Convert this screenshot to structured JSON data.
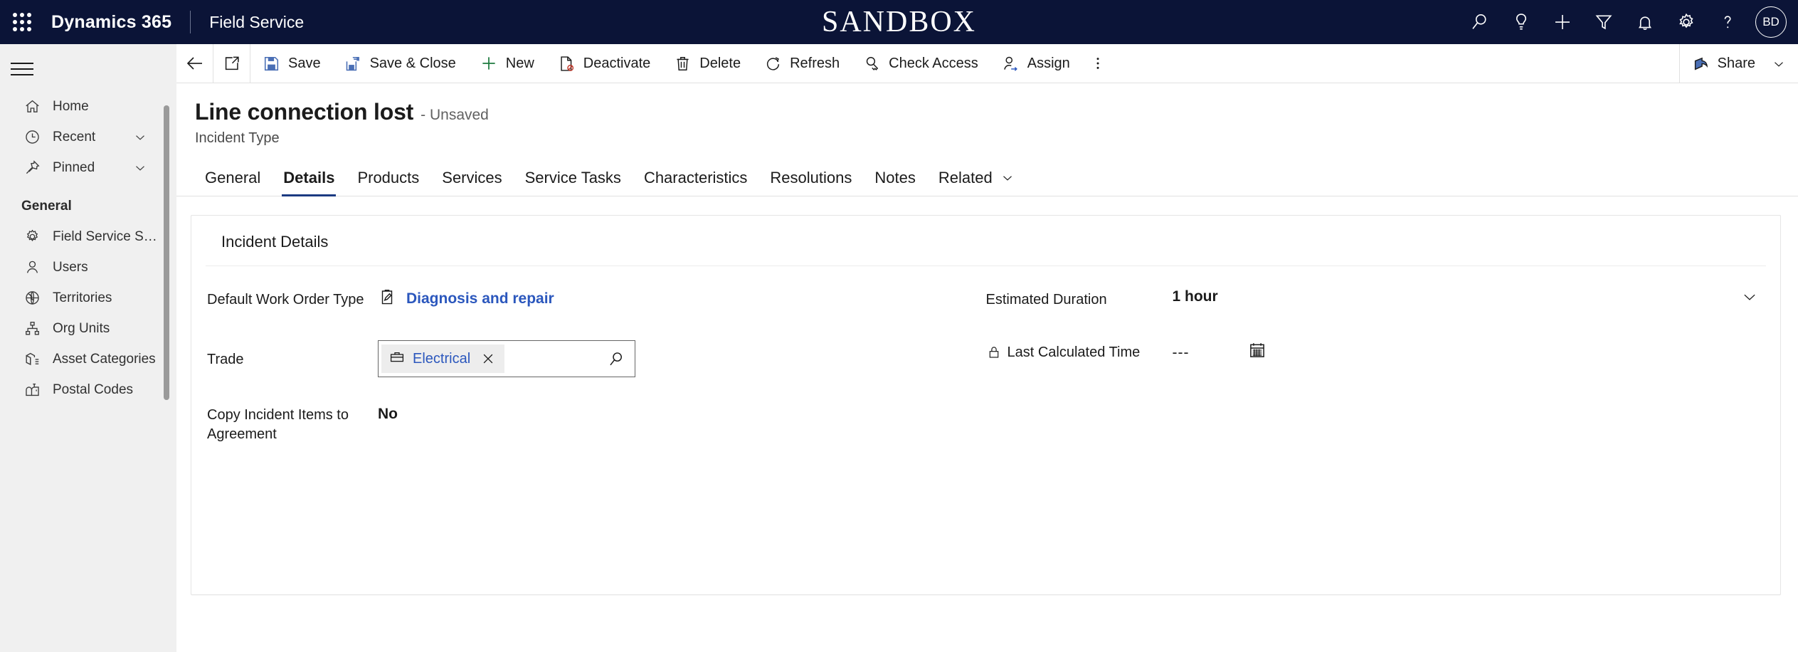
{
  "header": {
    "waffle_label": "app-launcher",
    "brand": "Dynamics 365",
    "app_name": "Field Service",
    "environment_banner": "SANDBOX",
    "icons": [
      {
        "name": "search-icon",
        "label": "Search"
      },
      {
        "name": "lightbulb-icon",
        "label": "Insights"
      },
      {
        "name": "plus-icon",
        "label": "New"
      },
      {
        "name": "filter-icon",
        "label": "Filter"
      },
      {
        "name": "bell-icon",
        "label": "Notifications"
      },
      {
        "name": "gear-icon",
        "label": "Settings"
      },
      {
        "name": "question-icon",
        "label": "Help"
      }
    ],
    "avatar_initials": "BD"
  },
  "sidebar": {
    "hamburger_label": "Expand navigation",
    "items": [
      {
        "label": "Home",
        "icon": "home-icon",
        "chevron": false
      },
      {
        "label": "Recent",
        "icon": "clock-icon",
        "chevron": true
      },
      {
        "label": "Pinned",
        "icon": "pin-icon",
        "chevron": true
      }
    ],
    "group_label": "General",
    "group_items": [
      {
        "label": "Field Service Setti...",
        "icon": "gear-icon"
      },
      {
        "label": "Users",
        "icon": "user-icon"
      },
      {
        "label": "Territories",
        "icon": "globe-icon"
      },
      {
        "label": "Org Units",
        "icon": "org-chart-icon"
      },
      {
        "label": "Asset Categories",
        "icon": "asset-box-icon"
      },
      {
        "label": "Postal Codes",
        "icon": "mailbox-icon"
      }
    ]
  },
  "command_bar": {
    "back_label": "Back",
    "popout_label": "Open in new window",
    "buttons": [
      {
        "label": "Save",
        "icon": "save-icon"
      },
      {
        "label": "Save & Close",
        "icon": "save-close-icon"
      },
      {
        "label": "New",
        "icon": "plus-icon"
      },
      {
        "label": "Deactivate",
        "icon": "deactivate-icon"
      },
      {
        "label": "Delete",
        "icon": "trash-icon"
      },
      {
        "label": "Refresh",
        "icon": "refresh-icon"
      },
      {
        "label": "Check Access",
        "icon": "key-icon"
      },
      {
        "label": "Assign",
        "icon": "assign-user-icon"
      }
    ],
    "overflow_label": "More commands",
    "share_label": "Share"
  },
  "record": {
    "title": "Line connection lost",
    "state": "- Unsaved",
    "entity": "Incident Type"
  },
  "tabs": [
    {
      "label": "General",
      "active": false
    },
    {
      "label": "Details",
      "active": true
    },
    {
      "label": "Products",
      "active": false
    },
    {
      "label": "Services",
      "active": false
    },
    {
      "label": "Service Tasks",
      "active": false
    },
    {
      "label": "Characteristics",
      "active": false
    },
    {
      "label": "Resolutions",
      "active": false
    },
    {
      "label": "Notes",
      "active": false
    },
    {
      "label": "Related",
      "active": false
    }
  ],
  "form": {
    "section_title": "Incident Details",
    "fields": {
      "default_work_order_type": {
        "label": "Default Work Order Type",
        "value": "Diagnosis and repair",
        "icon": "work-order-icon"
      },
      "trade": {
        "label": "Trade",
        "chip_value": "Electrical",
        "chip_icon": "briefcase-icon",
        "remove_label": "Remove",
        "search_label": "Lookup"
      },
      "copy_incident_items": {
        "label": "Copy Incident Items to Agreement",
        "value": "No"
      },
      "estimated_duration": {
        "label": "Estimated Duration",
        "value": "1 hour",
        "chevron_label": "Open duration list"
      },
      "last_calculated_time": {
        "label": "Last Calculated Time",
        "value": "---",
        "lock_icon": "lock-icon",
        "calendar_label": "Select date"
      }
    }
  },
  "colors": {
    "header_bg": "#0b1437",
    "accent_link": "#2b57bd",
    "tab_underline": "#1b3a82",
    "sidebar_bg": "#f0f0f0",
    "new_icon_green": "#1d7a3e",
    "deactivate_red": "#c0392b"
  }
}
